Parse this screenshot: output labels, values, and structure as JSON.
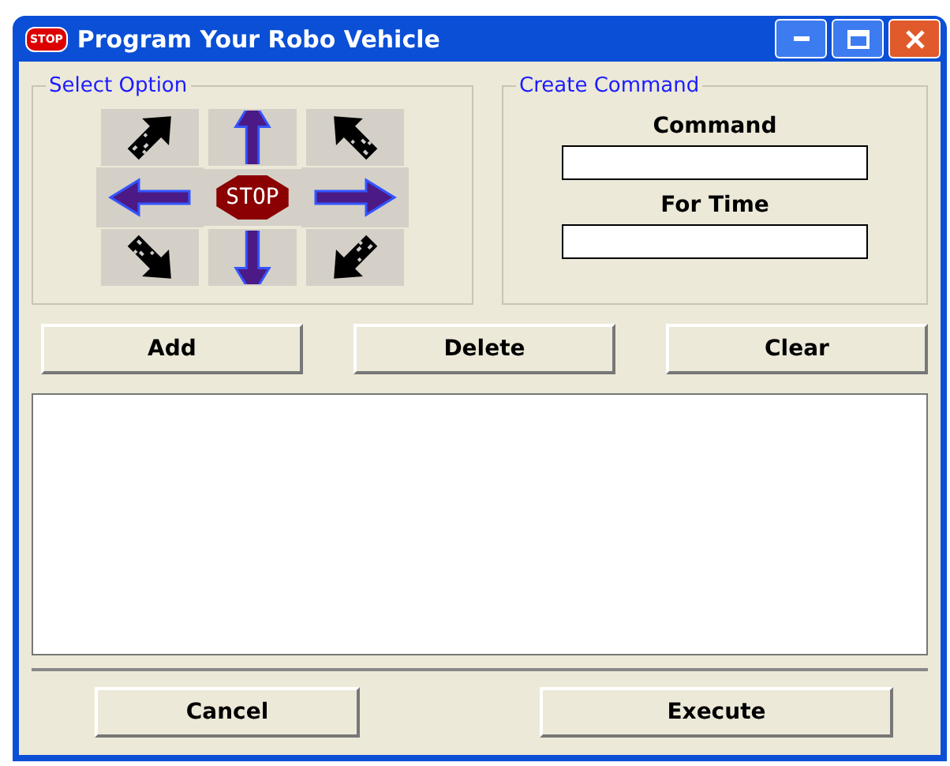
{
  "window": {
    "title": "Program Your Robo Vehicle",
    "icon_text": "STOP"
  },
  "select_option": {
    "label": "Select Option",
    "directions": [
      {
        "kind": "diag_ul"
      },
      {
        "kind": "up"
      },
      {
        "kind": "diag_ur"
      },
      {
        "kind": "left"
      },
      {
        "kind": "stop",
        "text": "STOP"
      },
      {
        "kind": "right"
      },
      {
        "kind": "diag_dl"
      },
      {
        "kind": "down"
      },
      {
        "kind": "diag_dr"
      }
    ]
  },
  "create_command": {
    "label": "Create Command",
    "fields": [
      {
        "label": "Command"
      },
      {
        "label": "For Time"
      }
    ]
  },
  "buttons": [
    "Add",
    "Delete",
    "Clear"
  ],
  "bottom_buttons": [
    "Cancel",
    "Execute"
  ]
}
